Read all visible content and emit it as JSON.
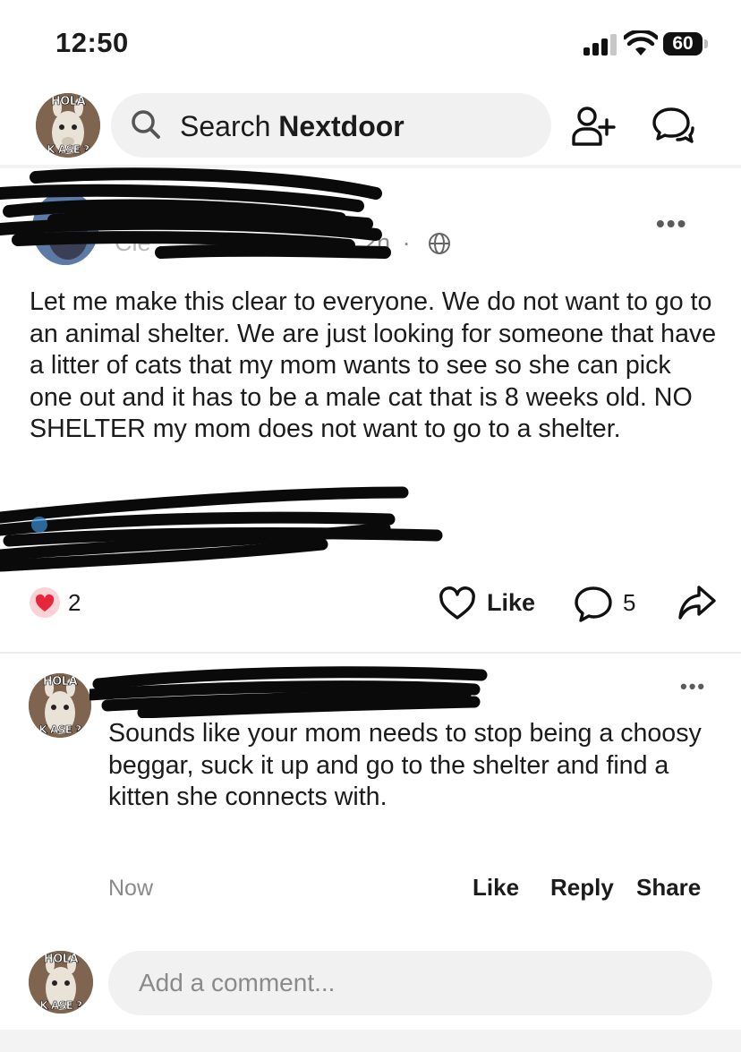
{
  "status_bar": {
    "time": "12:50",
    "battery": "60"
  },
  "header": {
    "search_prefix": "Search",
    "search_brand": "Nextdoor",
    "avatar_caption_top": "HOLA",
    "avatar_caption_bottom": "K ASE ?",
    "icons": [
      "search-icon",
      "add-person-icon",
      "chat-icon"
    ]
  },
  "post": {
    "meta_time": "2h",
    "meta_separator": "·",
    "body": "Let me make this clear to everyone. We do not want to go to an animal shelter. We are just looking for someone that have a litter of cats that my mom wants to see so she can pick one out and it has to be a male cat that is 8 weeks old. NO SHELTER my mom does not want to go to a shelter.",
    "reactions": {
      "count": "2",
      "icon": "heart-icon"
    },
    "actions": {
      "like_label": "Like",
      "comment_count": "5"
    }
  },
  "comment": {
    "avatar_caption_top": "HOLA",
    "avatar_caption_bottom": "K ASE ?",
    "body": "Sounds like your mom needs to stop being a choosy beggar, suck it up and go to the shelter and find a kitten she connects with.",
    "time": "Now",
    "actions": {
      "like": "Like",
      "reply": "Reply",
      "share": "Share"
    }
  },
  "composer": {
    "placeholder": "Add a comment...",
    "avatar_caption_top": "HOLA",
    "avatar_caption_bottom": "K ASE ?"
  },
  "colors": {
    "heart": "#e8263b",
    "scribble": "#0a0a0a",
    "muted_text": "#8a8a8a",
    "pill_bg": "#f1f1f1"
  }
}
